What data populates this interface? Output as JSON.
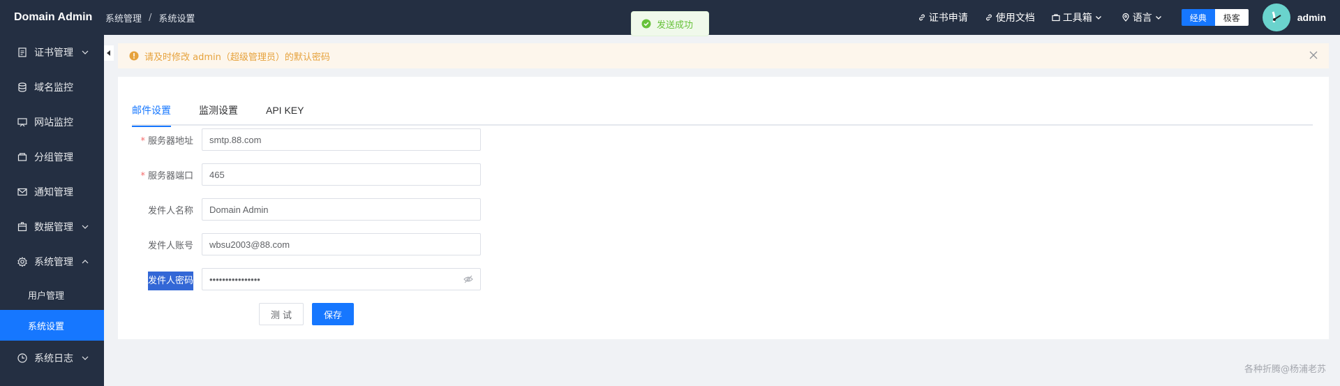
{
  "app": {
    "title": "Domain Admin"
  },
  "breadcrumb": [
    "系统管理",
    "系统设置"
  ],
  "header": {
    "links": [
      {
        "label": "证书申请",
        "icon": "link-icon"
      },
      {
        "label": "使用文档",
        "icon": "link-icon"
      },
      {
        "label": "工具箱",
        "icon": "toolbox-icon"
      },
      {
        "label": "语言",
        "icon": "location-icon"
      }
    ],
    "theme": {
      "classic": "经典",
      "geek": "极客"
    },
    "user": "admin"
  },
  "toast": {
    "message": "发送成功",
    "color": "#67c23a"
  },
  "sidebar": {
    "items": [
      {
        "label": "证书管理",
        "icon": "document-icon"
      },
      {
        "label": "域名监控",
        "icon": "database-icon"
      },
      {
        "label": "网站监控",
        "icon": "monitor-icon"
      },
      {
        "label": "分组管理",
        "icon": "folder-icon"
      },
      {
        "label": "通知管理",
        "icon": "mail-icon"
      },
      {
        "label": "数据管理",
        "icon": "box-icon"
      },
      {
        "label": "系统管理",
        "icon": "setting-icon"
      },
      {
        "label": "系统日志",
        "icon": "clock-icon"
      }
    ],
    "sub_items": [
      {
        "label": "用户管理",
        "active": false
      },
      {
        "label": "系统设置",
        "active": true
      }
    ],
    "accent": "#1677ff"
  },
  "alert": {
    "message": "请及时修改 admin（超级管理员）的默认密码",
    "color": "#e6a23c"
  },
  "tabs": [
    {
      "label": "邮件设置",
      "active": true
    },
    {
      "label": "监测设置",
      "active": false
    },
    {
      "label": "API KEY",
      "active": false
    }
  ],
  "form": {
    "fields": [
      {
        "label": "服务器地址",
        "value": "smtp.88.com",
        "required": true
      },
      {
        "label": "服务器端口",
        "value": "465",
        "required": true
      },
      {
        "label": "发件人名称",
        "value": "Domain Admin",
        "required": false
      },
      {
        "label": "发件人账号",
        "value": "wbsu2003@88.com",
        "required": false
      },
      {
        "label": "发件人密码",
        "value": "••••••••••••••••",
        "required": false
      }
    ],
    "test_label": "测 试",
    "save_label": "保存"
  },
  "watermark": "各种折腾@杨浦老苏"
}
